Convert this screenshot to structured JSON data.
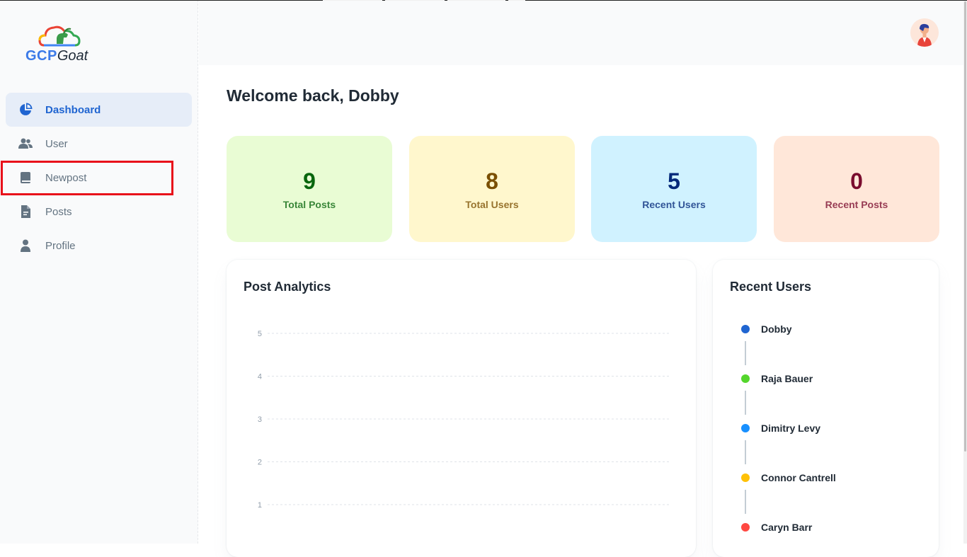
{
  "brand": {
    "logo_primary": "GCP",
    "logo_secondary": "Goat"
  },
  "sidebar": {
    "items": [
      {
        "label": "Dashboard",
        "icon": "pie-chart-icon",
        "active": true
      },
      {
        "label": "User",
        "icon": "people-icon",
        "active": false
      },
      {
        "label": "Newpost",
        "icon": "book-icon",
        "active": false
      },
      {
        "label": "Posts",
        "icon": "file-text-icon",
        "active": false
      },
      {
        "label": "Profile",
        "icon": "person-icon",
        "active": false
      }
    ]
  },
  "header": {
    "avatar": "user-avatar"
  },
  "main": {
    "welcome": "Welcome back, Dobby",
    "stats": [
      {
        "value": "9",
        "label": "Total Posts",
        "bg": "#e9fcd4",
        "fg": "#08660d"
      },
      {
        "value": "8",
        "label": "Total Users",
        "bg": "#fff7cd",
        "fg": "#7a4f01"
      },
      {
        "value": "5",
        "label": "Recent Users",
        "bg": "#d0f2ff",
        "fg": "#04297a"
      },
      {
        "value": "0",
        "label": "Recent Posts",
        "bg": "#ffe7d9",
        "fg": "#7a0c2e"
      }
    ],
    "analytics": {
      "title": "Post Analytics"
    },
    "recent_users": {
      "title": "Recent Users",
      "users": [
        {
          "name": "Dobby",
          "color": "#2065d1"
        },
        {
          "name": "Raja Bauer",
          "color": "#54d62c"
        },
        {
          "name": "Dimitry Levy",
          "color": "#1890ff"
        },
        {
          "name": "Connor Cantrell",
          "color": "#ffc107"
        },
        {
          "name": "Caryn Barr",
          "color": "#ff4842"
        }
      ]
    }
  },
  "chart_data": {
    "type": "line",
    "title": "Post Analytics",
    "y_ticks": [
      "5",
      "4",
      "3",
      "2",
      "1"
    ],
    "ylim": [
      1,
      5
    ],
    "grid": true,
    "series": []
  }
}
